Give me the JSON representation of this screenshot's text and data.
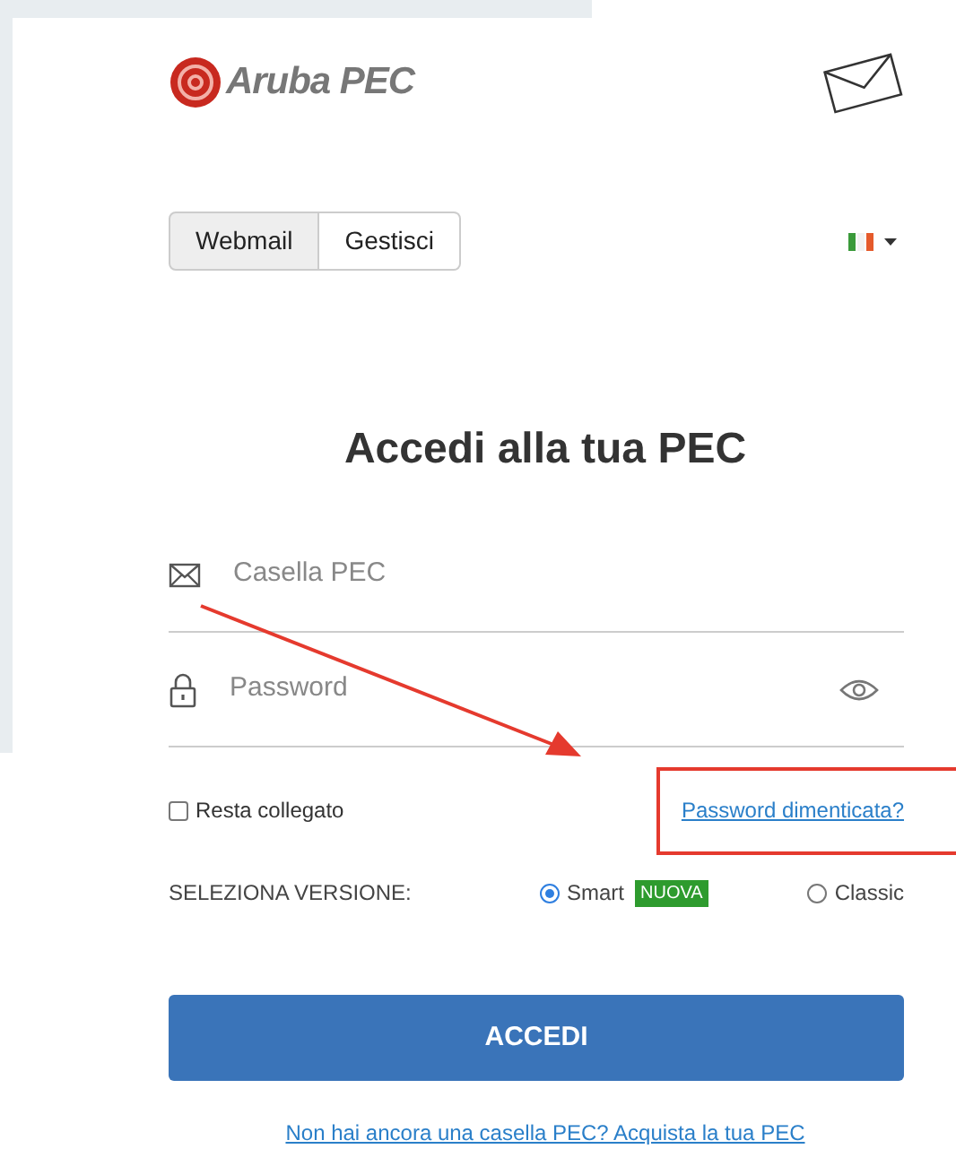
{
  "logo": {
    "text": "Aruba PEC"
  },
  "tabs": [
    {
      "label": "Webmail",
      "selected": true
    },
    {
      "label": "Gestisci",
      "selected": false
    }
  ],
  "heading": "Accedi alla tua PEC",
  "fields": [
    {
      "kind": "email",
      "placeholder": "Casella PEC"
    },
    {
      "kind": "password",
      "placeholder": "Password"
    }
  ],
  "remember": {
    "label": "Resta collegato",
    "checked": false
  },
  "forgot_link": "Password dimenticata?",
  "version": {
    "label": "SELEZIONA VERSIONE:",
    "options": [
      {
        "label": "Smart",
        "badge": "NUOVA",
        "selected": true
      },
      {
        "label": "Classic",
        "selected": false
      }
    ]
  },
  "submit": "ACCEDI",
  "signup_link": "Non hai ancora una casella PEC? Acquista la tua PEC"
}
